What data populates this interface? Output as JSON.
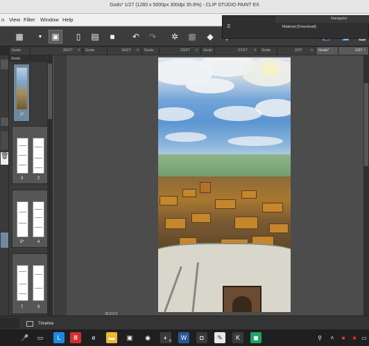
{
  "window": {
    "title": "Gods* 1/27 (1280 x 5000px 300dpi 35.8%) - CLIP STUDIO PAINT EX"
  },
  "menubar": {
    "items": [
      "n",
      "View",
      "Filter",
      "Window",
      "Help"
    ]
  },
  "floating_panel": {
    "navigator_label": "Navigator",
    "material_label": "Material [Download]"
  },
  "tabs": [
    {
      "label": "Gods",
      "active": false
    },
    {
      "label": "26/27",
      "active": false
    },
    {
      "label": "Gods",
      "active": false
    },
    {
      "label": "34/27",
      "active": false
    },
    {
      "label": "Gods",
      "active": false
    },
    {
      "label": "23/27",
      "active": false
    },
    {
      "label": "Gods",
      "active": false
    },
    {
      "label": "27/27",
      "active": false
    },
    {
      "label": "Gods",
      "active": false
    },
    {
      "label": "2/27",
      "active": false
    },
    {
      "label": "Gods*",
      "active": true
    },
    {
      "label": "1/27",
      "active": true
    }
  ],
  "pages_panel": {
    "header": "Gods",
    "pages": [
      {
        "labels": [
          "1*"
        ],
        "colored": true,
        "selected": true
      },
      {
        "labels": [
          "3",
          "2"
        ],
        "colored": false,
        "selected": false
      },
      {
        "labels": [
          "5*",
          "4"
        ],
        "colored": false,
        "selected": false
      },
      {
        "labels": [
          "7",
          "6"
        ],
        "colored": false,
        "selected": false
      }
    ]
  },
  "canvas": {
    "zoom_readout": "35.8 0 0"
  },
  "timeline": {
    "label": "Timeline"
  },
  "taskbar": {
    "apps": [
      {
        "name": "microphone-icon",
        "glyph": "🎤",
        "color": "#1f1f1f"
      },
      {
        "name": "task-view-icon",
        "glyph": "▭",
        "color": "#1f1f1f"
      },
      {
        "name": "l-app-icon",
        "glyph": "L",
        "color": "#1e88e5"
      },
      {
        "name": "red-app-icon",
        "glyph": "Ⅲ",
        "color": "#d32f2f"
      },
      {
        "name": "edge-icon",
        "glyph": "e",
        "color": "#1f1f1f"
      },
      {
        "name": "folder-icon",
        "glyph": "▬",
        "color": "#f2b632"
      },
      {
        "name": "store-icon",
        "glyph": "▣",
        "color": "#1f1f1f"
      },
      {
        "name": "chrome-icon",
        "glyph": "◉",
        "color": "#1f1f1f"
      },
      {
        "name": "app-badge-icon",
        "glyph": "◐",
        "color": "#3a3a3a"
      },
      {
        "name": "word-icon",
        "glyph": "W",
        "color": "#2b579a"
      },
      {
        "name": "camera-icon",
        "glyph": "◘",
        "color": "#3a3a3a"
      },
      {
        "name": "csp-icon",
        "glyph": "✎",
        "color": "#e8e8e8"
      },
      {
        "name": "pen-app-icon",
        "glyph": "K",
        "color": "#3a3a3a"
      },
      {
        "name": "chat-icon",
        "glyph": "◼",
        "color": "#1fa363"
      }
    ],
    "badge_count": "6"
  },
  "colors": {
    "toolbar_bg": "#3c3c3c",
    "canvas_bg": "#4c4c4c",
    "selection": "#6f8aa0"
  }
}
